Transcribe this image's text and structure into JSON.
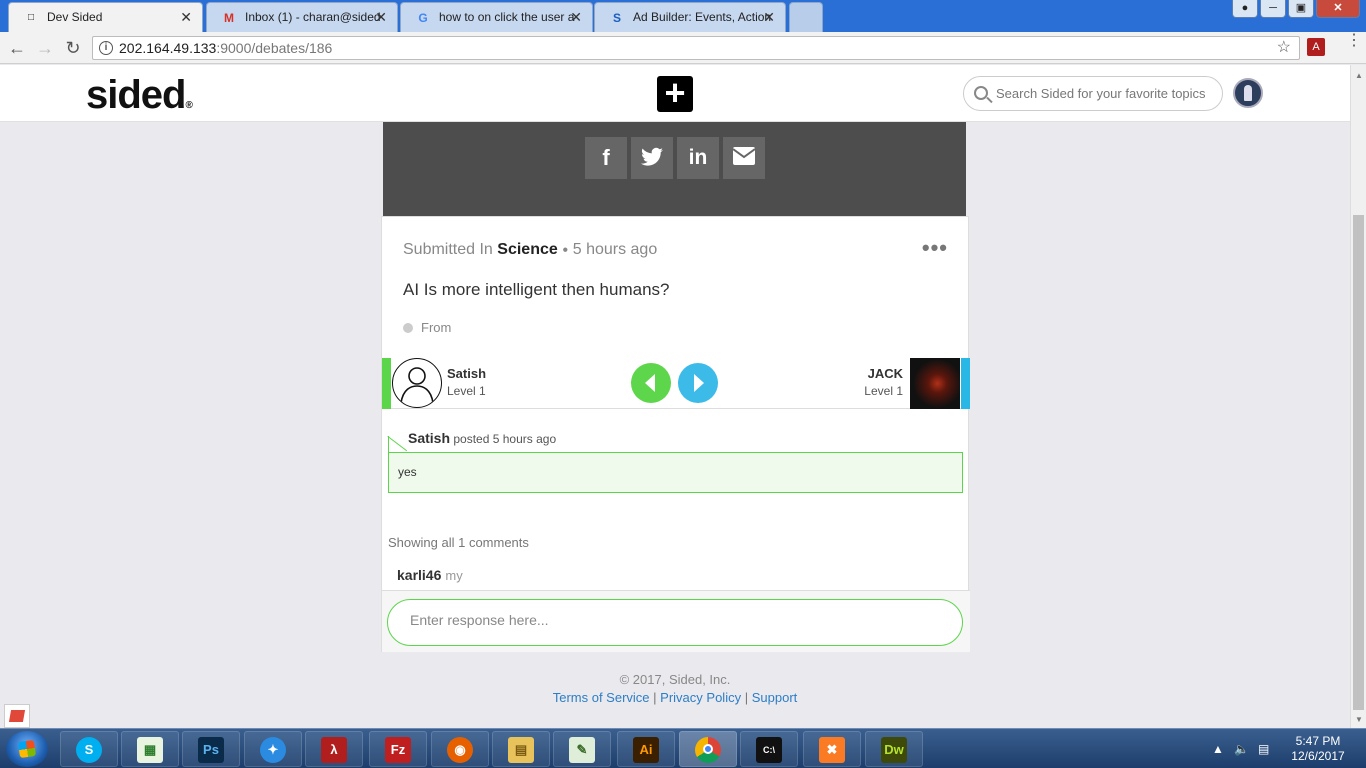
{
  "browser": {
    "tabs": [
      {
        "title": "Dev Sided",
        "favicon": "sided-favicon",
        "active": true
      },
      {
        "title": "Inbox (1) - charan@sided",
        "favicon": "gmail-icon",
        "active": false
      },
      {
        "title": "how to on click the user a",
        "favicon": "google-icon",
        "active": false
      },
      {
        "title": "Ad Builder: Events, Action",
        "favicon": "si-favicon",
        "active": false
      }
    ],
    "close_glyph": "✕",
    "url_host": "202.164.49.133",
    "url_path": ":9000/debates/186"
  },
  "site": {
    "logo": "sided",
    "logo_mark": "®",
    "search_placeholder": "Search Sided for your favorite topics"
  },
  "debate": {
    "submitted_prefix": "Submitted In",
    "category": "Science",
    "time_ago": "5 hours ago",
    "question": "AI Is more intelligent then humans?",
    "from_label": "From",
    "left_user": {
      "name": "Satish",
      "level": "Level 1"
    },
    "right_user": {
      "name": "JACK",
      "level": "Level 1"
    },
    "post": {
      "author": "Satish",
      "action": "posted",
      "time": "5 hours ago",
      "text": "yes"
    },
    "comments_summary": "Showing all 1 comments",
    "comment": {
      "author": "karli46",
      "text": "my"
    },
    "response_placeholder": "Enter response here..."
  },
  "footer": {
    "copyright": "© 2017, Sided, Inc.",
    "links": [
      "Terms of Service",
      "Privacy Policy",
      "Support"
    ]
  },
  "taskbar": {
    "time": "5:47 PM",
    "date": "12/6/2017",
    "apps": [
      "skype-icon",
      "spreadsheet-icon",
      "photoshop-icon",
      "app-icon",
      "acrobat-icon",
      "filezilla-icon",
      "firefox-icon",
      "explorer-icon",
      "notepad-icon",
      "illustrator-icon",
      "chrome-icon",
      "cmd-icon",
      "xampp-icon",
      "dreamweaver-icon"
    ]
  },
  "colors": {
    "accent_green": "#5bd64a",
    "accent_blue": "#29b7e6",
    "link_blue": "#2d7ec7",
    "share_panel": "#4d4d4d"
  }
}
